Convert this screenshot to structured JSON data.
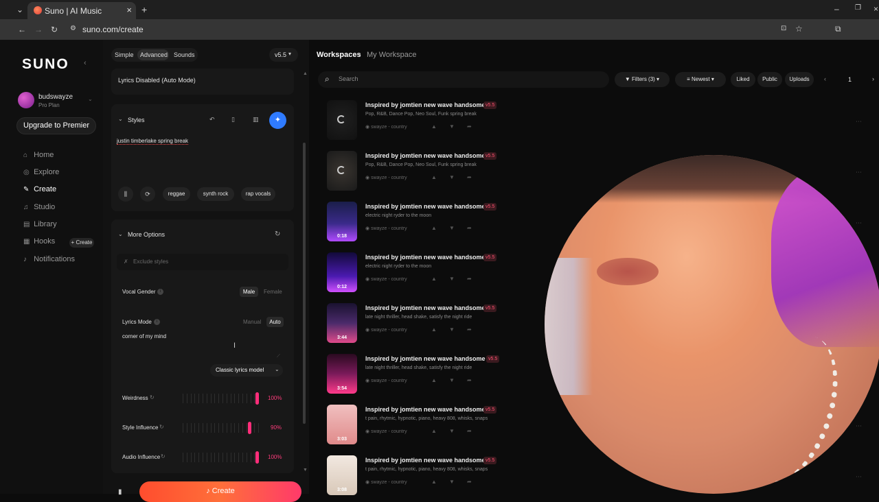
{
  "browser": {
    "tab_title": "Suno | AI Music",
    "url": "suno.com/create"
  },
  "sidebar": {
    "logo": "SUNO",
    "user_name": "budswayze",
    "user_plan": "Pro Plan",
    "upgrade_label": "Upgrade to Premier",
    "items": [
      {
        "label": "Home",
        "icon": "home-icon"
      },
      {
        "label": "Explore",
        "icon": "compass-icon"
      },
      {
        "label": "Create",
        "icon": "pen-icon",
        "active": true
      },
      {
        "label": "Studio",
        "icon": "studio-icon"
      },
      {
        "label": "Library",
        "icon": "library-icon"
      },
      {
        "label": "Hooks",
        "icon": "hook-icon"
      },
      {
        "label": "Notifications",
        "icon": "bell-icon"
      }
    ],
    "hooks_create": "+ Create"
  },
  "create_panel": {
    "tabs": [
      "Simple",
      "Advanced",
      "Sounds"
    ],
    "version": "v5.5",
    "lyrics_disabled": "Lyrics Disabled (Auto Mode)",
    "styles_title": "Styles",
    "styles_text": "justin timberlake spring break",
    "style_tags": [
      "reggae",
      "synth rock",
      "rap vocals"
    ],
    "more_options": "More Options",
    "exclude_placeholder": "Exclude styles",
    "vocal_gender_label": "Vocal Gender",
    "vocal_male": "Male",
    "vocal_female": "Female",
    "lyrics_mode_label": "Lyrics Mode",
    "lyrics_manual": "Manual",
    "lyrics_auto": "Auto",
    "lyrics_text": "corner of my mind",
    "lyrics_model": "Classic lyrics model",
    "sliders": [
      {
        "label": "Weirdness",
        "value": "100%",
        "fraction": 1.0
      },
      {
        "label": "Style Influence",
        "value": "90%",
        "fraction": 0.9
      },
      {
        "label": "Audio Influence",
        "value": "100%",
        "fraction": 1.0
      }
    ],
    "create_label": "Create"
  },
  "workspace": {
    "crumb_root": "Workspaces",
    "crumb_current": "My Workspace",
    "search_placeholder": "Search",
    "filters": "Filters (3)",
    "sort": "Newest",
    "liked": "Liked",
    "public": "Public",
    "uploads": "Uploads",
    "page": "1",
    "songs": [
      {
        "title": "Inspired by jomtien new wave handsome",
        "version": "v5.5",
        "desc": "Pop, R&B, Dance Pop, Neo Soul, Funk spring break",
        "artist": "swayze - country",
        "duration": "",
        "loading": true
      },
      {
        "title": "Inspired by jomtien new wave handsome",
        "version": "v5.5",
        "desc": "Pop, R&B, Dance Pop, Neo Soul, Funk spring break",
        "artist": "swayze - country",
        "duration": "",
        "loading": true
      },
      {
        "title": "Inspired by jomtien new wave handsome",
        "version": "v5.5",
        "desc": "electric night ryder to the moon",
        "artist": "swayze - country",
        "duration": "0:18"
      },
      {
        "title": "Inspired by jomtien new wave handsome",
        "version": "v5.5",
        "desc": "electric night ryder to the moon",
        "artist": "swayze - country",
        "duration": "0:12"
      },
      {
        "title": "Inspired by jomtien new wave handsome",
        "version": "v5.5",
        "desc": "late night thriller, head shake, satisfy the night ride",
        "artist": "swayze - country",
        "duration": "3:44"
      },
      {
        "title": "Inspired by jomtien new wave handsome",
        "version": "v5.5",
        "desc": "late night thriller, head shake, satisfy the night ride",
        "artist": "swayze - country",
        "duration": "3:54"
      },
      {
        "title": "Inspired by jomtien new wave handsome",
        "version": "v5.5",
        "desc": "t pain, rhytmic, hypnotic, piano, heavy 808, whisks, snaps",
        "artist": "swayze - country",
        "duration": "3:03"
      },
      {
        "title": "Inspired by jomtien new wave handsome",
        "version": "v5.5",
        "desc": "t pain, rhytmic, hypnotic, piano, heavy 808, whisks, snaps",
        "artist": "swayze - country",
        "duration": "3:08"
      }
    ]
  }
}
